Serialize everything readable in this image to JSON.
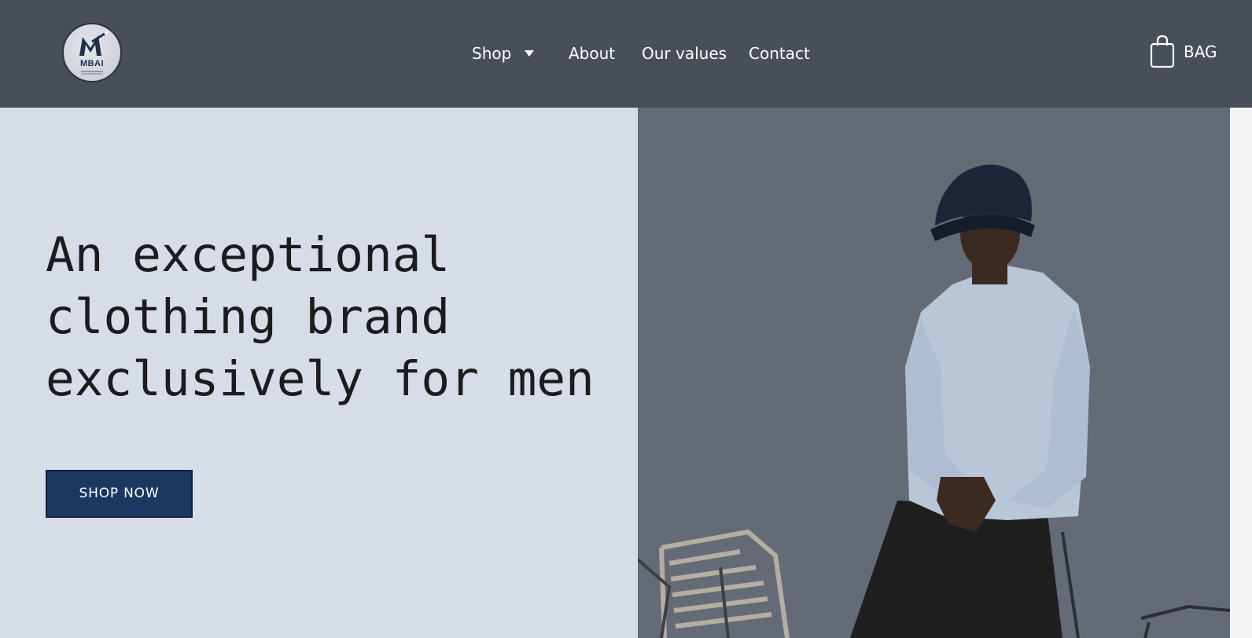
{
  "brand": {
    "logo_text": "MBAI",
    "logo_icon": "m-monogram-icon"
  },
  "nav": {
    "items": [
      {
        "label": "Shop",
        "has_dropdown": true
      },
      {
        "label": "About"
      },
      {
        "label": "Our values"
      },
      {
        "label": "Contact"
      }
    ]
  },
  "cart": {
    "label": "BAG",
    "icon": "shopping-bag-icon"
  },
  "hero": {
    "headline_lines": [
      "An exceptional",
      "clothing brand",
      "exclusively for men"
    ],
    "cta_label": "SHOP NOW"
  },
  "colors": {
    "header_bg": "#484f57",
    "hero_left_bg": "#d6dde6",
    "cta_bg": "#1c3760",
    "photo_bg": "#646b77",
    "text_dark": "#1c1c1c"
  }
}
